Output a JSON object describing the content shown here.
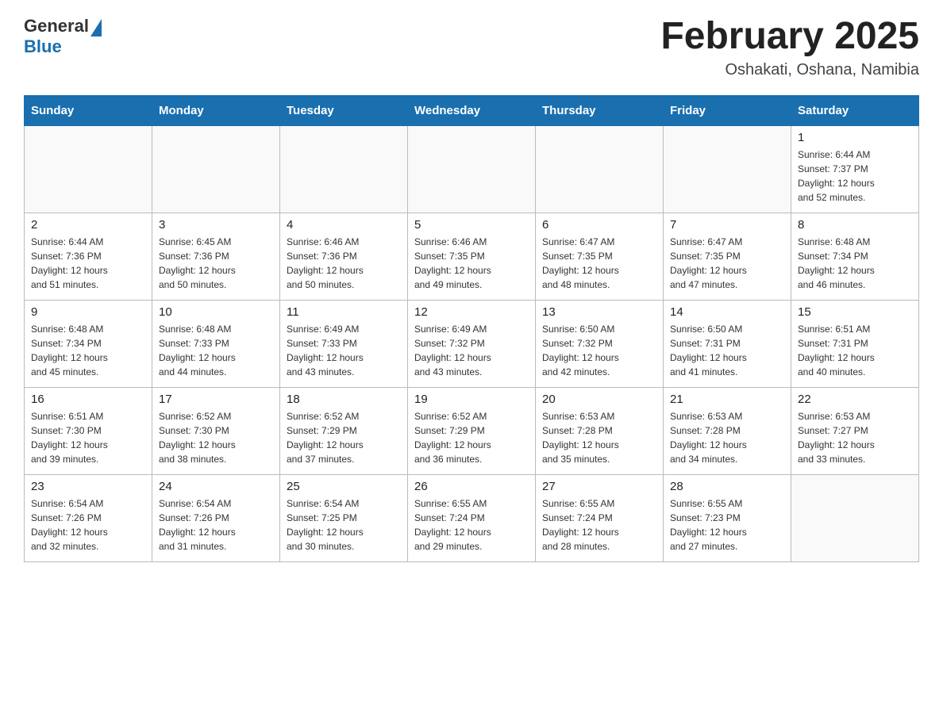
{
  "logo": {
    "text_general": "General",
    "text_blue": "Blue"
  },
  "header": {
    "month": "February 2025",
    "location": "Oshakati, Oshana, Namibia"
  },
  "days_of_week": [
    "Sunday",
    "Monday",
    "Tuesday",
    "Wednesday",
    "Thursday",
    "Friday",
    "Saturday"
  ],
  "weeks": [
    [
      {
        "day": "",
        "info": ""
      },
      {
        "day": "",
        "info": ""
      },
      {
        "day": "",
        "info": ""
      },
      {
        "day": "",
        "info": ""
      },
      {
        "day": "",
        "info": ""
      },
      {
        "day": "",
        "info": ""
      },
      {
        "day": "1",
        "info": "Sunrise: 6:44 AM\nSunset: 7:37 PM\nDaylight: 12 hours\nand 52 minutes."
      }
    ],
    [
      {
        "day": "2",
        "info": "Sunrise: 6:44 AM\nSunset: 7:36 PM\nDaylight: 12 hours\nand 51 minutes."
      },
      {
        "day": "3",
        "info": "Sunrise: 6:45 AM\nSunset: 7:36 PM\nDaylight: 12 hours\nand 50 minutes."
      },
      {
        "day": "4",
        "info": "Sunrise: 6:46 AM\nSunset: 7:36 PM\nDaylight: 12 hours\nand 50 minutes."
      },
      {
        "day": "5",
        "info": "Sunrise: 6:46 AM\nSunset: 7:35 PM\nDaylight: 12 hours\nand 49 minutes."
      },
      {
        "day": "6",
        "info": "Sunrise: 6:47 AM\nSunset: 7:35 PM\nDaylight: 12 hours\nand 48 minutes."
      },
      {
        "day": "7",
        "info": "Sunrise: 6:47 AM\nSunset: 7:35 PM\nDaylight: 12 hours\nand 47 minutes."
      },
      {
        "day": "8",
        "info": "Sunrise: 6:48 AM\nSunset: 7:34 PM\nDaylight: 12 hours\nand 46 minutes."
      }
    ],
    [
      {
        "day": "9",
        "info": "Sunrise: 6:48 AM\nSunset: 7:34 PM\nDaylight: 12 hours\nand 45 minutes."
      },
      {
        "day": "10",
        "info": "Sunrise: 6:48 AM\nSunset: 7:33 PM\nDaylight: 12 hours\nand 44 minutes."
      },
      {
        "day": "11",
        "info": "Sunrise: 6:49 AM\nSunset: 7:33 PM\nDaylight: 12 hours\nand 43 minutes."
      },
      {
        "day": "12",
        "info": "Sunrise: 6:49 AM\nSunset: 7:32 PM\nDaylight: 12 hours\nand 43 minutes."
      },
      {
        "day": "13",
        "info": "Sunrise: 6:50 AM\nSunset: 7:32 PM\nDaylight: 12 hours\nand 42 minutes."
      },
      {
        "day": "14",
        "info": "Sunrise: 6:50 AM\nSunset: 7:31 PM\nDaylight: 12 hours\nand 41 minutes."
      },
      {
        "day": "15",
        "info": "Sunrise: 6:51 AM\nSunset: 7:31 PM\nDaylight: 12 hours\nand 40 minutes."
      }
    ],
    [
      {
        "day": "16",
        "info": "Sunrise: 6:51 AM\nSunset: 7:30 PM\nDaylight: 12 hours\nand 39 minutes."
      },
      {
        "day": "17",
        "info": "Sunrise: 6:52 AM\nSunset: 7:30 PM\nDaylight: 12 hours\nand 38 minutes."
      },
      {
        "day": "18",
        "info": "Sunrise: 6:52 AM\nSunset: 7:29 PM\nDaylight: 12 hours\nand 37 minutes."
      },
      {
        "day": "19",
        "info": "Sunrise: 6:52 AM\nSunset: 7:29 PM\nDaylight: 12 hours\nand 36 minutes."
      },
      {
        "day": "20",
        "info": "Sunrise: 6:53 AM\nSunset: 7:28 PM\nDaylight: 12 hours\nand 35 minutes."
      },
      {
        "day": "21",
        "info": "Sunrise: 6:53 AM\nSunset: 7:28 PM\nDaylight: 12 hours\nand 34 minutes."
      },
      {
        "day": "22",
        "info": "Sunrise: 6:53 AM\nSunset: 7:27 PM\nDaylight: 12 hours\nand 33 minutes."
      }
    ],
    [
      {
        "day": "23",
        "info": "Sunrise: 6:54 AM\nSunset: 7:26 PM\nDaylight: 12 hours\nand 32 minutes."
      },
      {
        "day": "24",
        "info": "Sunrise: 6:54 AM\nSunset: 7:26 PM\nDaylight: 12 hours\nand 31 minutes."
      },
      {
        "day": "25",
        "info": "Sunrise: 6:54 AM\nSunset: 7:25 PM\nDaylight: 12 hours\nand 30 minutes."
      },
      {
        "day": "26",
        "info": "Sunrise: 6:55 AM\nSunset: 7:24 PM\nDaylight: 12 hours\nand 29 minutes."
      },
      {
        "day": "27",
        "info": "Sunrise: 6:55 AM\nSunset: 7:24 PM\nDaylight: 12 hours\nand 28 minutes."
      },
      {
        "day": "28",
        "info": "Sunrise: 6:55 AM\nSunset: 7:23 PM\nDaylight: 12 hours\nand 27 minutes."
      },
      {
        "day": "",
        "info": ""
      }
    ]
  ]
}
